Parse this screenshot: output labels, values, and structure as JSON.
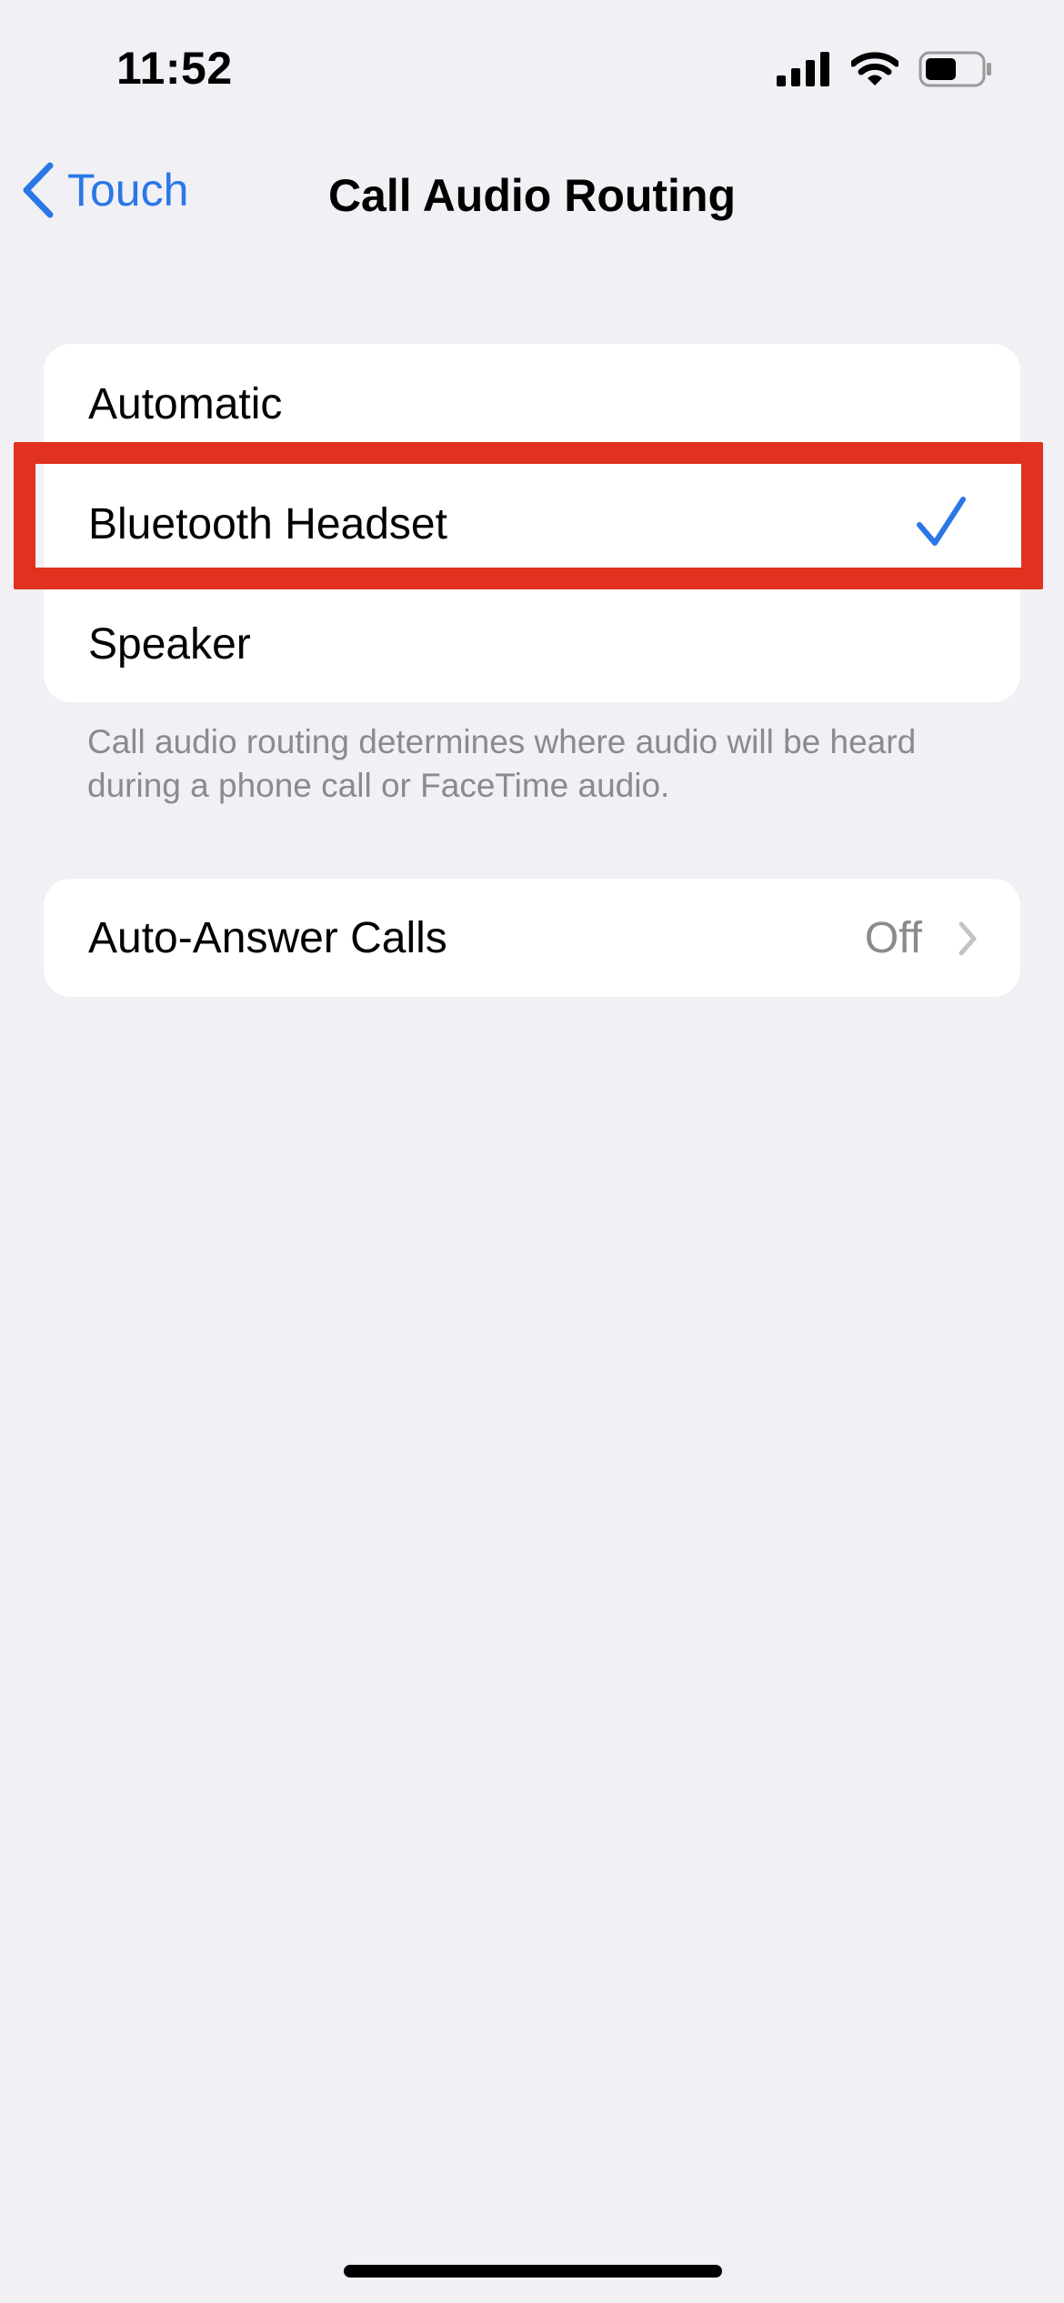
{
  "status_bar": {
    "time": "11:52",
    "icons": [
      "cellular-signal-icon",
      "wifi-icon",
      "battery-icon"
    ]
  },
  "nav": {
    "back_label": "Touch",
    "title": "Call Audio Routing"
  },
  "routing": {
    "options": [
      {
        "label": "Automatic",
        "selected": false
      },
      {
        "label": "Bluetooth Headset",
        "selected": true
      },
      {
        "label": "Speaker",
        "selected": false
      }
    ],
    "footer": "Call audio routing determines where audio will be heard during a phone call or FaceTime audio."
  },
  "auto_answer": {
    "label": "Auto-Answer Calls",
    "value": "Off"
  },
  "colors": {
    "accent": "#2b77e6",
    "highlight": "#e0321f",
    "background": "#f0f0f5"
  }
}
